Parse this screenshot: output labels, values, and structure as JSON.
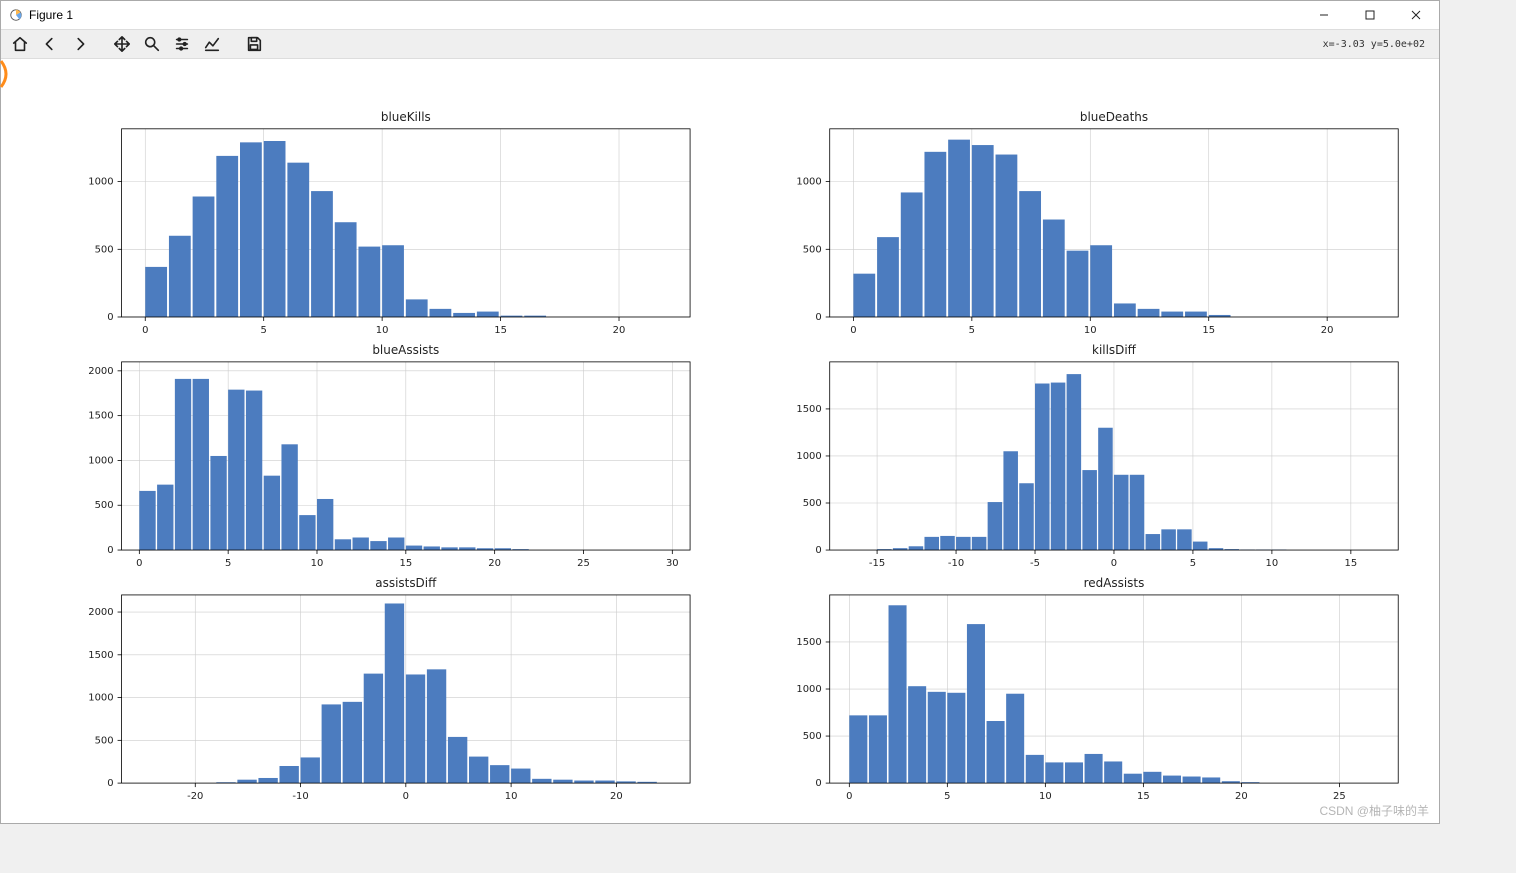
{
  "window": {
    "title": "Figure 1"
  },
  "toolbar": {
    "home": "Home",
    "back": "Back",
    "forward": "Forward",
    "pan": "Pan",
    "zoom": "Zoom",
    "configure": "Configure subplots",
    "edit": "Edit axis",
    "save": "Save"
  },
  "readout": {
    "text": "x=-3.03 y=5.0e+02"
  },
  "watermark": "CSDN @柚子味的羊",
  "chart_data": [
    {
      "type": "bar",
      "title": "blueKills",
      "xlabel": "",
      "ylabel": "",
      "xlim": [
        -1,
        23
      ],
      "ylim": [
        0,
        1390
      ],
      "xticks": [
        0,
        5,
        10,
        15,
        20
      ],
      "yticks": [
        0,
        500,
        1000
      ],
      "categories": [
        0,
        1,
        2,
        3,
        4,
        5,
        6,
        7,
        8,
        9,
        10,
        11,
        12,
        13,
        14,
        15,
        16
      ],
      "values": [
        370,
        600,
        890,
        1190,
        1290,
        1300,
        1140,
        930,
        700,
        520,
        530,
        130,
        60,
        30,
        40,
        10,
        10
      ]
    },
    {
      "type": "bar",
      "title": "blueDeaths",
      "xlabel": "",
      "ylabel": "",
      "xlim": [
        -1,
        23
      ],
      "ylim": [
        0,
        1390
      ],
      "xticks": [
        0,
        5,
        10,
        15,
        20
      ],
      "yticks": [
        0,
        500,
        1000
      ],
      "categories": [
        0,
        1,
        2,
        3,
        4,
        5,
        6,
        7,
        8,
        9,
        10,
        11,
        12,
        13,
        14,
        15
      ],
      "values": [
        320,
        590,
        920,
        1220,
        1310,
        1270,
        1200,
        930,
        720,
        490,
        530,
        100,
        60,
        40,
        40,
        15
      ]
    },
    {
      "type": "bar",
      "title": "blueAssists",
      "xlabel": "",
      "ylabel": "",
      "xlim": [
        -1,
        31
      ],
      "ylim": [
        0,
        2100
      ],
      "xticks": [
        0,
        5,
        10,
        15,
        20,
        25,
        30
      ],
      "yticks": [
        0,
        500,
        1000,
        1500,
        2000
      ],
      "categories": [
        0,
        1,
        2,
        3,
        4,
        5,
        6,
        7,
        8,
        9,
        10,
        11,
        12,
        13,
        14,
        15,
        16,
        17,
        18,
        19,
        20,
        21
      ],
      "values": [
        660,
        730,
        1910,
        1910,
        1050,
        1790,
        1780,
        830,
        1180,
        390,
        570,
        120,
        140,
        100,
        140,
        50,
        40,
        30,
        30,
        20,
        20,
        10
      ]
    },
    {
      "type": "bar",
      "title": "killsDiff",
      "xlabel": "",
      "ylabel": "",
      "xlim": [
        -18,
        18
      ],
      "ylim": [
        0,
        2000
      ],
      "xticks": [
        -15,
        -10,
        -5,
        0,
        5,
        10,
        15
      ],
      "yticks": [
        0,
        500,
        1000,
        1500
      ],
      "categories": [
        -15,
        -14,
        -13,
        -12,
        -11,
        -10,
        -9,
        -8,
        -7,
        -6,
        -5,
        -4,
        -3,
        -2,
        -1,
        0,
        1,
        2,
        3,
        4,
        5,
        6,
        7,
        8,
        9,
        10
      ],
      "values": [
        10,
        20,
        40,
        140,
        150,
        140,
        140,
        510,
        1050,
        710,
        1770,
        1780,
        1870,
        850,
        1300,
        800,
        800,
        170,
        220,
        220,
        90,
        20,
        10,
        5,
        5,
        5
      ]
    },
    {
      "type": "bar",
      "title": "assistsDiff",
      "xlabel": "",
      "ylabel": "",
      "xlim": [
        -27,
        27
      ],
      "ylim": [
        0,
        2200
      ],
      "xticks": [
        -20,
        -10,
        0,
        10,
        20
      ],
      "yticks": [
        0,
        500,
        1000,
        1500,
        2000
      ],
      "categories": [
        -18,
        -16,
        -14,
        -12,
        -10,
        -8,
        -6,
        -4,
        -2,
        0,
        2,
        4,
        6,
        8,
        10,
        12,
        14,
        16,
        18,
        20,
        22
      ],
      "values": [
        10,
        40,
        60,
        200,
        300,
        920,
        950,
        1280,
        2100,
        1270,
        1330,
        540,
        310,
        210,
        170,
        50,
        40,
        30,
        30,
        20,
        15
      ]
    },
    {
      "type": "bar",
      "title": "redAssists",
      "xlabel": "",
      "ylabel": "",
      "xlim": [
        -1,
        28
      ],
      "ylim": [
        0,
        2000
      ],
      "xticks": [
        0,
        5,
        10,
        15,
        20,
        25
      ],
      "yticks": [
        0,
        500,
        1000,
        1500
      ],
      "categories": [
        0,
        1,
        2,
        3,
        4,
        5,
        6,
        7,
        8,
        9,
        10,
        11,
        12,
        13,
        14,
        15,
        16,
        17,
        18,
        19,
        20
      ],
      "values": [
        720,
        720,
        1890,
        1030,
        970,
        960,
        1690,
        660,
        950,
        300,
        220,
        220,
        310,
        230,
        100,
        120,
        80,
        70,
        60,
        20,
        10
      ]
    }
  ]
}
